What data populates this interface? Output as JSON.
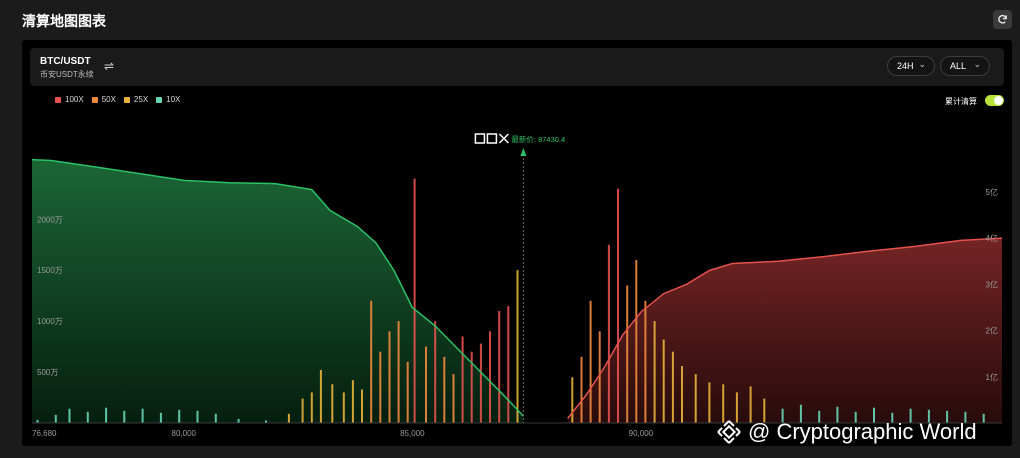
{
  "page": {
    "title": "清算地图图表"
  },
  "pair": {
    "name": "BTC/USDT",
    "sub": "币安USDT永续"
  },
  "selects": {
    "range": "24H",
    "filter": "ALL"
  },
  "legend": [
    {
      "label": "100X",
      "color": "#e5524f"
    },
    {
      "label": "50X",
      "color": "#f08a3d"
    },
    {
      "label": "25X",
      "color": "#e8b23a"
    },
    {
      "label": "10X",
      "color": "#67d6b7"
    }
  ],
  "toggle": {
    "label": "累计清算",
    "on": true
  },
  "price_marker": {
    "label": "最新价: 87430.4",
    "value": 87430.4
  },
  "watermark": {
    "text": "@ Cryptographic World"
  },
  "chart_data": {
    "type": "bar",
    "x_ticks": [
      "76,680",
      "80,000",
      "85,000",
      "90,000"
    ],
    "x_tick_values": [
      76680,
      80000,
      85000,
      90000
    ],
    "xlim": [
      76680,
      97900
    ],
    "left_axis": {
      "ticks": [
        "500万",
        "1000万",
        "1500万",
        "2000万"
      ],
      "values": [
        500,
        1000,
        1500,
        2000
      ],
      "ylim": [
        0,
        2700
      ]
    },
    "right_axis": {
      "ticks": [
        "1亿",
        "2亿",
        "3亿",
        "4亿",
        "5亿"
      ],
      "values": [
        1,
        2,
        3,
        4,
        5
      ],
      "ylim": [
        0,
        5.95
      ]
    },
    "long_cumulative": {
      "name": "long",
      "color": "#2bc166",
      "x": [
        76680,
        77100,
        78000,
        79000,
        80000,
        81000,
        82000,
        82800,
        83200,
        83800,
        84200,
        84600,
        85000,
        85500,
        86000,
        86500,
        87000,
        87430
      ],
      "y": [
        5.7,
        5.68,
        5.55,
        5.4,
        5.25,
        5.2,
        5.18,
        5.05,
        4.6,
        4.25,
        3.9,
        3.3,
        2.5,
        2.1,
        1.6,
        1.1,
        0.6,
        0.15
      ]
    },
    "short_cumulative": {
      "name": "short",
      "color": "#e5524f",
      "x": [
        88400,
        88800,
        89200,
        89600,
        90000,
        90500,
        91000,
        91500,
        92000,
        93000,
        94000,
        95000,
        96000,
        97000,
        97900
      ],
      "y": [
        0.1,
        0.6,
        1.2,
        1.9,
        2.4,
        2.8,
        3.0,
        3.3,
        3.45,
        3.5,
        3.6,
        3.72,
        3.82,
        3.95,
        4.0
      ]
    },
    "bars": [
      {
        "x": 76800,
        "v": 30,
        "lev": "10X"
      },
      {
        "x": 77200,
        "v": 80,
        "lev": "10X"
      },
      {
        "x": 77500,
        "v": 140,
        "lev": "10X"
      },
      {
        "x": 77900,
        "v": 110,
        "lev": "10X"
      },
      {
        "x": 78300,
        "v": 150,
        "lev": "10X"
      },
      {
        "x": 78700,
        "v": 120,
        "lev": "10X"
      },
      {
        "x": 79100,
        "v": 140,
        "lev": "10X"
      },
      {
        "x": 79500,
        "v": 100,
        "lev": "10X"
      },
      {
        "x": 79900,
        "v": 130,
        "lev": "10X"
      },
      {
        "x": 80300,
        "v": 120,
        "lev": "10X"
      },
      {
        "x": 80700,
        "v": 90,
        "lev": "10X"
      },
      {
        "x": 81200,
        "v": 40,
        "lev": "10X"
      },
      {
        "x": 81800,
        "v": 25,
        "lev": "10X"
      },
      {
        "x": 82300,
        "v": 90,
        "lev": "25X"
      },
      {
        "x": 82600,
        "v": 240,
        "lev": "25X"
      },
      {
        "x": 82800,
        "v": 300,
        "lev": "25X"
      },
      {
        "x": 83000,
        "v": 520,
        "lev": "25X"
      },
      {
        "x": 83250,
        "v": 380,
        "lev": "25X"
      },
      {
        "x": 83500,
        "v": 300,
        "lev": "25X"
      },
      {
        "x": 83700,
        "v": 420,
        "lev": "25X"
      },
      {
        "x": 83900,
        "v": 330,
        "lev": "25X"
      },
      {
        "x": 84100,
        "v": 1200,
        "lev": "50X"
      },
      {
        "x": 84300,
        "v": 700,
        "lev": "50X"
      },
      {
        "x": 84500,
        "v": 900,
        "lev": "50X"
      },
      {
        "x": 84700,
        "v": 1000,
        "lev": "50X"
      },
      {
        "x": 84900,
        "v": 600,
        "lev": "50X"
      },
      {
        "x": 85050,
        "v": 2400,
        "lev": "100X"
      },
      {
        "x": 85300,
        "v": 750,
        "lev": "50X"
      },
      {
        "x": 85500,
        "v": 1000,
        "lev": "100X"
      },
      {
        "x": 85700,
        "v": 650,
        "lev": "50X"
      },
      {
        "x": 85900,
        "v": 480,
        "lev": "50X"
      },
      {
        "x": 86100,
        "v": 850,
        "lev": "100X"
      },
      {
        "x": 86300,
        "v": 700,
        "lev": "100X"
      },
      {
        "x": 86500,
        "v": 780,
        "lev": "100X"
      },
      {
        "x": 86700,
        "v": 900,
        "lev": "100X"
      },
      {
        "x": 86900,
        "v": 1100,
        "lev": "100X"
      },
      {
        "x": 87100,
        "v": 1150,
        "lev": "100X"
      },
      {
        "x": 87300,
        "v": 1500,
        "lev": "25X"
      },
      {
        "x": 88500,
        "v": 450,
        "lev": "25X"
      },
      {
        "x": 88700,
        "v": 650,
        "lev": "50X"
      },
      {
        "x": 88900,
        "v": 1200,
        "lev": "50X"
      },
      {
        "x": 89100,
        "v": 900,
        "lev": "50X"
      },
      {
        "x": 89300,
        "v": 1750,
        "lev": "100X"
      },
      {
        "x": 89500,
        "v": 2300,
        "lev": "100X"
      },
      {
        "x": 89700,
        "v": 1350,
        "lev": "50X"
      },
      {
        "x": 89900,
        "v": 1600,
        "lev": "50X"
      },
      {
        "x": 90100,
        "v": 1200,
        "lev": "50X"
      },
      {
        "x": 90300,
        "v": 1000,
        "lev": "25X"
      },
      {
        "x": 90500,
        "v": 820,
        "lev": "25X"
      },
      {
        "x": 90700,
        "v": 700,
        "lev": "25X"
      },
      {
        "x": 90900,
        "v": 560,
        "lev": "25X"
      },
      {
        "x": 91200,
        "v": 480,
        "lev": "25X"
      },
      {
        "x": 91500,
        "v": 400,
        "lev": "25X"
      },
      {
        "x": 91800,
        "v": 380,
        "lev": "25X"
      },
      {
        "x": 92100,
        "v": 300,
        "lev": "25X"
      },
      {
        "x": 92400,
        "v": 360,
        "lev": "25X"
      },
      {
        "x": 92700,
        "v": 240,
        "lev": "25X"
      },
      {
        "x": 93100,
        "v": 140,
        "lev": "10X"
      },
      {
        "x": 93500,
        "v": 180,
        "lev": "10X"
      },
      {
        "x": 93900,
        "v": 120,
        "lev": "10X"
      },
      {
        "x": 94300,
        "v": 160,
        "lev": "10X"
      },
      {
        "x": 94700,
        "v": 110,
        "lev": "10X"
      },
      {
        "x": 95100,
        "v": 150,
        "lev": "10X"
      },
      {
        "x": 95500,
        "v": 100,
        "lev": "10X"
      },
      {
        "x": 95900,
        "v": 140,
        "lev": "10X"
      },
      {
        "x": 96300,
        "v": 130,
        "lev": "10X"
      },
      {
        "x": 96700,
        "v": 120,
        "lev": "10X"
      },
      {
        "x": 97100,
        "v": 110,
        "lev": "10X"
      },
      {
        "x": 97500,
        "v": 90,
        "lev": "10X"
      }
    ]
  }
}
